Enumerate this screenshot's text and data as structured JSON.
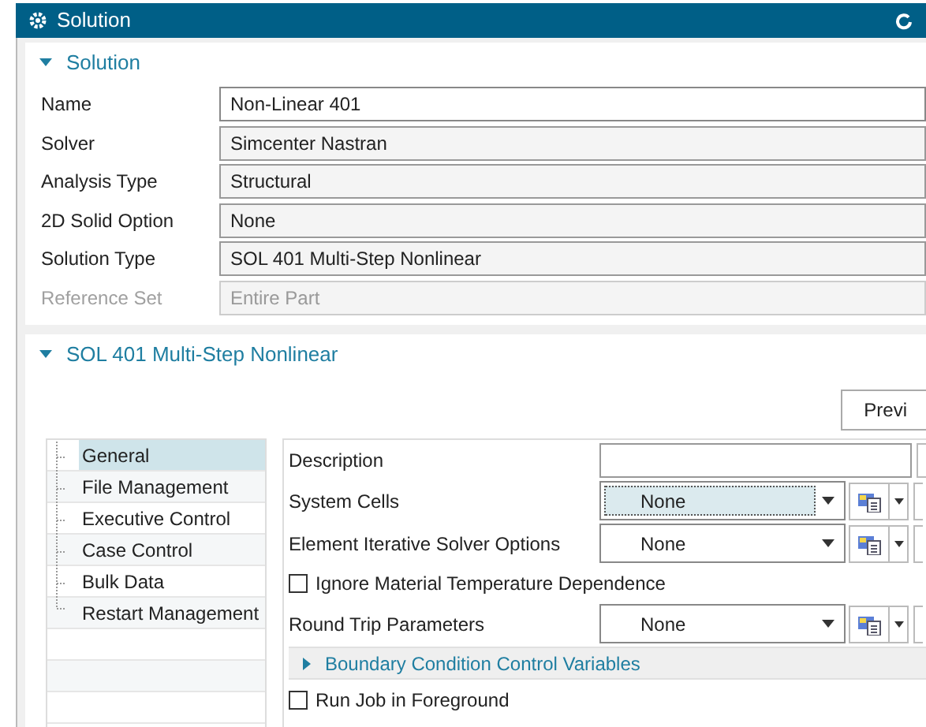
{
  "title_bar": {
    "title": "Solution"
  },
  "solution_section": {
    "title": "Solution",
    "expanded": true,
    "fields": [
      {
        "label": "Name",
        "value": "Non-Linear 401",
        "editable": true,
        "disabled": false
      },
      {
        "label": "Solver",
        "value": "Simcenter Nastran",
        "editable": false,
        "disabled": false
      },
      {
        "label": "Analysis Type",
        "value": "Structural",
        "editable": false,
        "disabled": false
      },
      {
        "label": "2D Solid Option",
        "value": "None",
        "editable": false,
        "disabled": false
      },
      {
        "label": "Solution Type",
        "value": "SOL 401 Multi-Step Nonlinear",
        "editable": false,
        "disabled": false
      },
      {
        "label": "Reference Set",
        "value": "Entire Part",
        "editable": false,
        "disabled": true
      }
    ]
  },
  "sol401_section": {
    "title": "SOL 401 Multi-Step Nonlinear",
    "expanded": true,
    "preview_button": "Previ",
    "tree": [
      {
        "label": "General",
        "selected": true
      },
      {
        "label": "File Management",
        "selected": false
      },
      {
        "label": "Executive Control",
        "selected": false
      },
      {
        "label": "Case Control",
        "selected": false
      },
      {
        "label": "Bulk Data",
        "selected": false
      },
      {
        "label": "Restart Management",
        "selected": false
      }
    ],
    "options": [
      {
        "kind": "text",
        "label": "Description"
      },
      {
        "kind": "dropdown",
        "label": "System Cells",
        "value": "None",
        "focused": true
      },
      {
        "kind": "dropdown",
        "label": "Element Iterative Solver Options",
        "value": "None",
        "focused": false
      },
      {
        "kind": "checkbox",
        "label": "Ignore Material Temperature Dependence",
        "checked": false
      },
      {
        "kind": "dropdown",
        "label": "Round Trip Parameters",
        "value": "None",
        "focused": false
      },
      {
        "kind": "group",
        "label": "Boundary Condition Control Variables",
        "expanded": false
      },
      {
        "kind": "checkbox",
        "label": "Run Job in Foreground",
        "checked": false
      }
    ]
  }
}
